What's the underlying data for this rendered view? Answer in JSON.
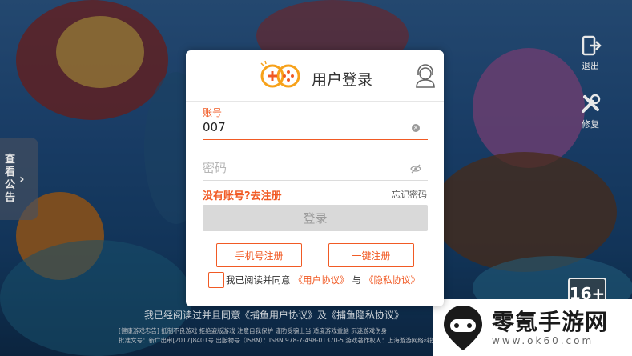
{
  "dialog": {
    "title": "用户登录",
    "account_label": "账号",
    "account_value": "007",
    "password_placeholder": "密码",
    "register_link": "没有账号?去注册",
    "forgot_link": "忘记密码",
    "login_button": "登录",
    "phone_register_button": "手机号注册",
    "oneclick_register_button": "一键注册",
    "agree_prefix": "我已阅读并同意",
    "user_agreement": "《用户协议》",
    "and_word": "与",
    "privacy_agreement": "《隐私协议》"
  },
  "side": {
    "notice_tab": "查看公告",
    "logout_label": "退出",
    "repair_label": "修复"
  },
  "background": {
    "age_badge": "16+",
    "agree_line": "我已经阅读过并且同意《捕鱼用户协议》及《捕鱼隐私协议》",
    "health_notice": "[健康游戏忠告] 抵制不良游戏 拒绝盗版游戏 注意自我保护 谨防受骗上当 适度游戏益脑 沉迷游戏伤身",
    "license_line": "批准文号：新广出审[2017]8401号 出版物号（ISBN）：ISBN 978-7-498-01370-5 游戏著作权人：上海游游网络科技有限公司"
  },
  "watermark": {
    "title": "零氪手游网",
    "url": "www.ok60.com"
  },
  "colors": {
    "accent": "#f15a24",
    "login_button_bg": "#d9d9d9",
    "dialog_bg": "#ffffff"
  },
  "icons": {
    "logo": "gamepad-logo-icon",
    "customer_service": "headset-icon",
    "clear": "clear-icon",
    "eye": "eye-hidden-icon",
    "logout": "exit-icon",
    "repair": "wrench-icon",
    "chevron": "chevron-right-icon"
  }
}
